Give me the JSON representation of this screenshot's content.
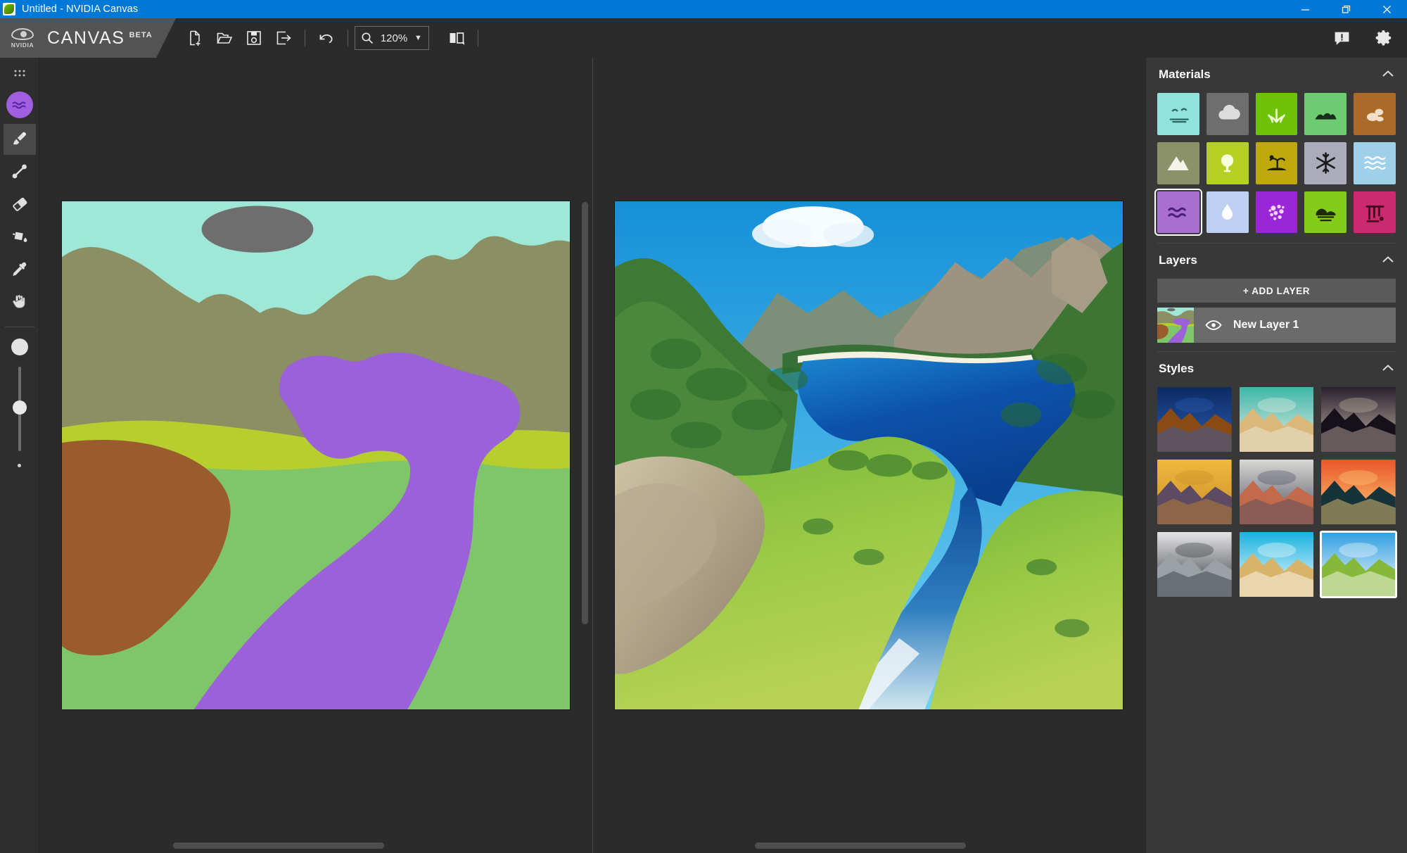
{
  "window": {
    "title": "Untitled - NVIDIA Canvas",
    "app_icon": "nvidia-canvas-icon",
    "minimize_label": "—",
    "restore_label": "❐",
    "close_label": "✕",
    "titlebar_color": "#0078d7"
  },
  "brand": {
    "vendor": "NVIDIA",
    "product": "CANVAS",
    "tag": "BETA"
  },
  "toolbar": {
    "new_label": "new-file",
    "open_label": "open-folder",
    "save_label": "save",
    "export_label": "export",
    "undo_label": "undo",
    "zoom_icon": "magnifier-icon",
    "zoom_value": "120%",
    "zoom_caret": "▼",
    "compare_label": "compare-view",
    "feedback_label": "feedback",
    "settings_label": "settings"
  },
  "rail": {
    "panels_icon": "grid-dots-icon",
    "current_material_color": "#a05ee0",
    "current_material_icon": "water-icon",
    "tools": [
      {
        "name": "paintbrush-tool",
        "active": true
      },
      {
        "name": "line-tool",
        "active": false
      },
      {
        "name": "eraser-tool",
        "active": false
      },
      {
        "name": "paint-bucket-tool",
        "active": false
      },
      {
        "name": "eyedropper-tool",
        "active": false
      },
      {
        "name": "pan-hand-tool",
        "active": false
      }
    ],
    "brush_size_label": "brush-size-slider",
    "brush_size_percent": 48
  },
  "canvas": {
    "segmentation_title": "segmentation-artboard",
    "output_title": "rendered-output-artboard",
    "segmentation_colors": {
      "sky": "#9fe7d6",
      "cloud": "#6e6e6e",
      "mountain": "#8b8f64",
      "grass_light": "#b6cf2e",
      "grass": "#7fc66b",
      "dirt": "#9a5c2c",
      "water": "#9a61d8"
    },
    "output_colors": {
      "sky": "#1fa8e8",
      "deep_water": "#0a4fa8",
      "lake": "#1572c4",
      "grass": "#8cc63f",
      "forest": "#2f7a2b",
      "rock": "#b9a98e",
      "snow": "#ffffff"
    }
  },
  "materials": {
    "title": "Materials",
    "collapse_icon": "chevron-up-icon",
    "items": [
      {
        "name": "sky",
        "color": "#8fe3dc",
        "icon": "sky-birds-icon",
        "ink": "#2b6660",
        "selected": false
      },
      {
        "name": "cloud",
        "color": "#6e6e6e",
        "icon": "cloud-icon",
        "ink": "#dcdcdc",
        "selected": false
      },
      {
        "name": "grass",
        "color": "#6ec20a",
        "icon": "grass-icon",
        "ink": "#f2ffd6",
        "selected": false
      },
      {
        "name": "bush",
        "color": "#6dcb71",
        "icon": "bush-hill-icon",
        "ink": "#16301a",
        "selected": false
      },
      {
        "name": "dirt",
        "color": "#ab6b28",
        "icon": "dirt-rocks-icon",
        "ink": "#f3dfc8",
        "selected": false
      },
      {
        "name": "mountain",
        "color": "#8b9169",
        "icon": "mountain-icon",
        "ink": "#f3f3ea",
        "selected": false
      },
      {
        "name": "tree",
        "color": "#b5d022",
        "icon": "tree-icon",
        "ink": "#f6ffd9",
        "selected": false
      },
      {
        "name": "island",
        "color": "#bfa80a",
        "icon": "island-palm-icon",
        "ink": "#1d1a05",
        "selected": false
      },
      {
        "name": "snow",
        "color": "#abacba",
        "icon": "snowflake-icon",
        "ink": "#1a1a1a",
        "selected": false
      },
      {
        "name": "sea",
        "color": "#9fd0ea",
        "icon": "sea-waves-icon",
        "ink": "#ffffff",
        "selected": false
      },
      {
        "name": "water",
        "color": "#a86ed2",
        "icon": "water-waves-icon",
        "ink": "#4a1f78",
        "selected": true
      },
      {
        "name": "fog",
        "color": "#bed0f2",
        "icon": "water-drop-icon",
        "ink": "#ffffff",
        "selected": false
      },
      {
        "name": "flowers",
        "color": "#9b26d9",
        "icon": "flowers-icon",
        "ink": "#f4d6ff",
        "selected": false
      },
      {
        "name": "hill",
        "color": "#83cc1c",
        "icon": "hill-icon",
        "ink": "#1d2c06",
        "selected": false
      },
      {
        "name": "ruins",
        "color": "#cc2a70",
        "icon": "ruins-icon",
        "ink": "#4a0720",
        "selected": false
      }
    ]
  },
  "layers": {
    "title": "Layers",
    "collapse_icon": "chevron-up-icon",
    "add_label": "+ ADD LAYER",
    "items": [
      {
        "name": "New Layer 1",
        "visible": true,
        "visibility_icon": "eye-icon",
        "thumbnail": "layer-thumbnail"
      }
    ]
  },
  "styles": {
    "title": "Styles",
    "collapse_icon": "chevron-up-icon",
    "items": [
      {
        "name": "desert-lightning",
        "selected": false,
        "sky": "#0d2a63",
        "ground": "#8a4a14",
        "accent": "#2a5fb5"
      },
      {
        "name": "cumulus-cloud",
        "selected": false,
        "sky": "#3db7a8",
        "ground": "#d9b87a",
        "accent": "#eeeee6"
      },
      {
        "name": "night-cave",
        "selected": false,
        "sky": "#2a2130",
        "ground": "#15101a",
        "accent": "#c9b9a8"
      },
      {
        "name": "golden-sunrise",
        "selected": false,
        "sky": "#f0b93c",
        "ground": "#5d4a63",
        "accent": "#c88a2a"
      },
      {
        "name": "red-rock-peaks",
        "selected": false,
        "sky": "#d8d8d4",
        "ground": "#c36a4c",
        "accent": "#4a4a5e"
      },
      {
        "name": "ocean-sunset",
        "selected": false,
        "sky": "#e8562a",
        "ground": "#17333a",
        "accent": "#ffd27a"
      },
      {
        "name": "monochrome-peaks",
        "selected": false,
        "sky": "#e4e4e6",
        "ground": "#9aa0a6",
        "accent": "#2e3338"
      },
      {
        "name": "tropical-shore",
        "selected": false,
        "sky": "#1ab2e0",
        "ground": "#d7b46a",
        "accent": "#ffffff"
      },
      {
        "name": "alpine-lake",
        "selected": true,
        "sky": "#2f9fe0",
        "ground": "#86b93a",
        "accent": "#ffffff"
      }
    ]
  }
}
